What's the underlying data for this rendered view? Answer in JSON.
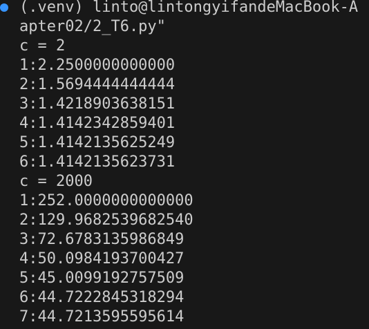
{
  "terminal": {
    "prompt_line": "(.venv) linto@lintongyifandeMacBook-A",
    "command_tail": "apter02/2_T6.py\"",
    "lines": [
      "c = 2",
      "1:2.2500000000000",
      "2:1.5694444444444",
      "3:1.4218903638151",
      "4:1.4142342859401",
      "5:1.4142135625249",
      "6:1.4142135623731",
      "c = 2000",
      "1:252.0000000000000",
      "2:129.9682539682540",
      "3:72.6783135986849",
      "4:50.0984193700427",
      "5:45.0099192757509",
      "6:44.7222845318294",
      "7:44.7213595595614"
    ],
    "colors": {
      "background": "#181818",
      "text": "#cccccc",
      "prompt_dot": "#3794ff"
    }
  }
}
